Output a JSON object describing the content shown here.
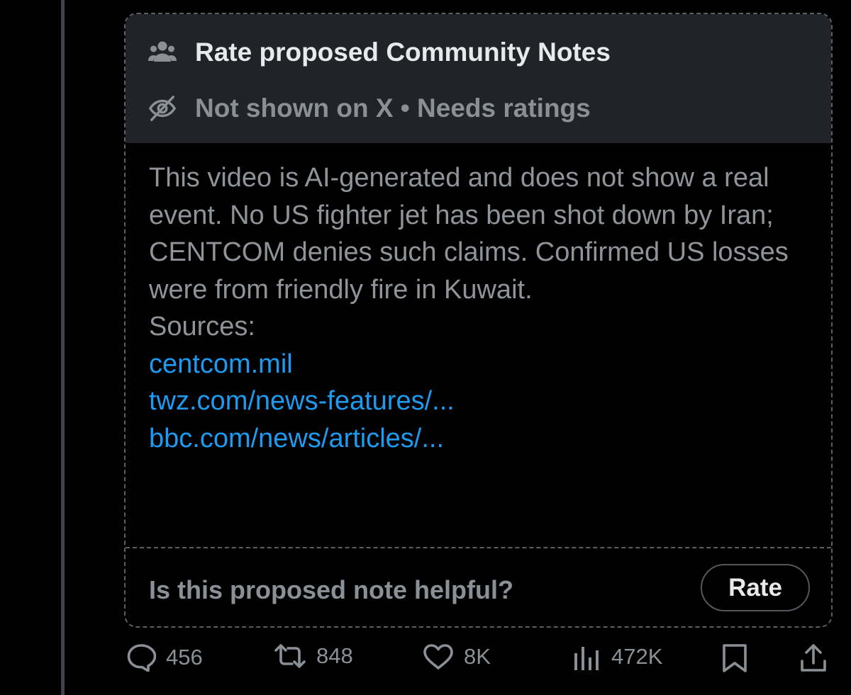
{
  "note": {
    "title": "Rate proposed Community Notes",
    "status": "Not shown on X • Needs ratings",
    "body": "This video is AI-generated and does not show a real event. No US fighter jet has been shot down by Iran; CENTCOM denies such claims. Confirmed US losses were from friendly fire in Kuwait.",
    "sources_label": "Sources:",
    "sources": [
      "centcom.mil",
      "twz.com/news-features/...",
      "bbc.com/news/articles/..."
    ],
    "helpful_question": "Is this proposed note helpful?",
    "rate_label": "Rate"
  },
  "actions": {
    "replies": "456",
    "reposts": "848",
    "likes": "8K",
    "views": "472K"
  },
  "icons": [
    "people-icon",
    "eye-slash-icon",
    "reply-icon",
    "repost-icon",
    "like-icon",
    "views-icon",
    "bookmark-icon",
    "share-icon"
  ],
  "colors": {
    "link": "#1d9bf0",
    "muted": "#8b9096",
    "header_bg": "#202327"
  }
}
